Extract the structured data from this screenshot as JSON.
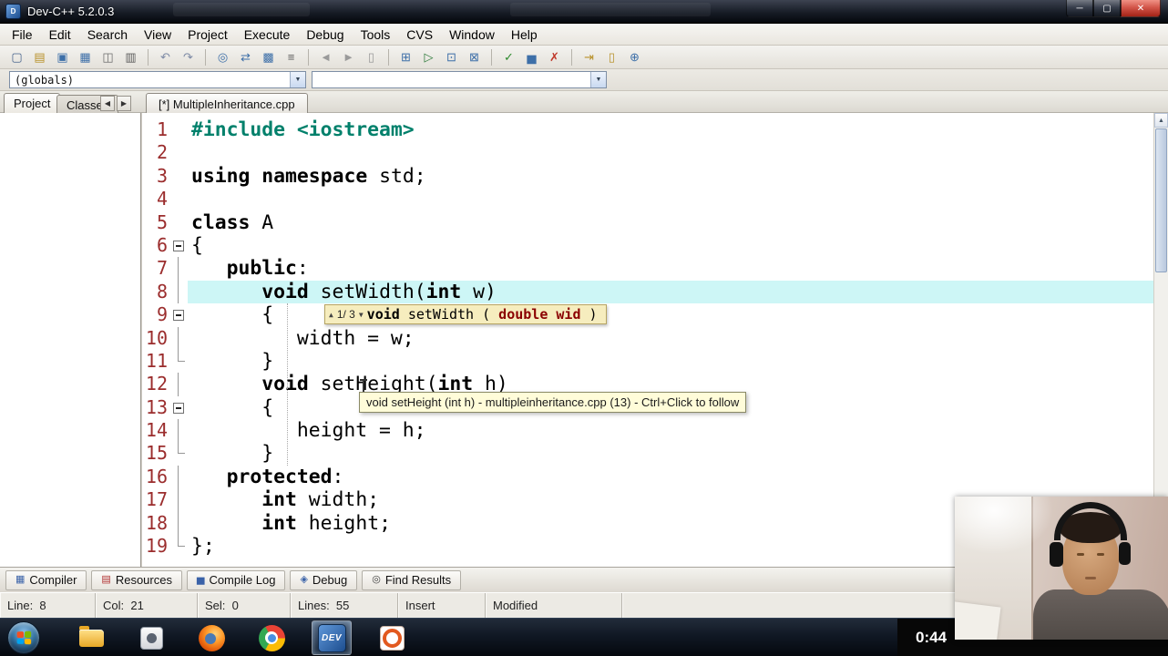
{
  "window": {
    "title": "Dev-C++ 5.2.0.3"
  },
  "menu": {
    "items": [
      "File",
      "Edit",
      "Search",
      "View",
      "Project",
      "Execute",
      "Debug",
      "Tools",
      "CVS",
      "Window",
      "Help"
    ]
  },
  "toolbar": {
    "items": [
      {
        "name": "new-file",
        "glyph": "▢",
        "color": "#46628c"
      },
      {
        "name": "open",
        "glyph": "▤",
        "color": "#b8912a"
      },
      {
        "name": "save",
        "glyph": "▣",
        "color": "#3d6fa8"
      },
      {
        "name": "save-all",
        "glyph": "▦",
        "color": "#3d6fa8"
      },
      {
        "name": "close-file",
        "glyph": "◫",
        "color": "#6d6d6d"
      },
      {
        "name": "print",
        "glyph": "▥",
        "color": "#5c5c5c"
      },
      {
        "sep": true
      },
      {
        "name": "undo",
        "glyph": "↶",
        "color": "#7d8aa5"
      },
      {
        "name": "redo",
        "glyph": "↷",
        "color": "#7d8aa5"
      },
      {
        "sep": true
      },
      {
        "name": "find",
        "glyph": "◎",
        "color": "#3d6fa8"
      },
      {
        "name": "replace",
        "glyph": "⇄",
        "color": "#3d6fa8"
      },
      {
        "name": "find-in-files",
        "glyph": "▩",
        "color": "#3d6fa8"
      },
      {
        "name": "goto-line",
        "glyph": "≡",
        "color": "#5c5c5c"
      },
      {
        "sep": true
      },
      {
        "name": "back",
        "glyph": "◄",
        "color": "#9a9a9a"
      },
      {
        "name": "forward",
        "glyph": "►",
        "color": "#9a9a9a"
      },
      {
        "name": "bookmarks",
        "glyph": "▯",
        "color": "#9a9a9a"
      },
      {
        "sep": true
      },
      {
        "name": "compile",
        "glyph": "⊞",
        "color": "#3d6fa8"
      },
      {
        "name": "run",
        "glyph": "▷",
        "color": "#2d7a3a"
      },
      {
        "name": "compile-and-run",
        "glyph": "⊡",
        "color": "#3d6fa8"
      },
      {
        "name": "rebuild-all",
        "glyph": "⊠",
        "color": "#3d6fa8"
      },
      {
        "sep": true
      },
      {
        "name": "syntax-check",
        "glyph": "✓",
        "color": "#2d8a2d"
      },
      {
        "name": "profile",
        "glyph": "▅",
        "color": "#3d6fa8"
      },
      {
        "name": "delete-profiling",
        "glyph": "✗",
        "color": "#c0392b"
      },
      {
        "sep": true
      },
      {
        "name": "goto-bookmark",
        "glyph": "⇥",
        "color": "#b8912a"
      },
      {
        "name": "toggle-bookmark",
        "glyph": "▯",
        "color": "#b8912a"
      },
      {
        "name": "insert-special",
        "glyph": "⊕",
        "color": "#3d6fa8"
      }
    ]
  },
  "combos": {
    "globals": "(globals)",
    "members": ""
  },
  "left_panel": {
    "tabs": [
      {
        "label": "Project"
      },
      {
        "label": "Classes"
      }
    ]
  },
  "editor": {
    "tab_label": "[*] MultipleInheritance.cpp"
  },
  "code": {
    "lines": [
      {
        "n": 1,
        "fold": "none",
        "hl": false,
        "seg": [
          [
            "#include <iostream>",
            "pre"
          ]
        ]
      },
      {
        "n": 2,
        "fold": "none",
        "hl": false,
        "seg": []
      },
      {
        "n": 3,
        "fold": "none",
        "hl": false,
        "seg": [
          [
            "using",
            "kw"
          ],
          [
            " ",
            "pl"
          ],
          [
            "namespace",
            "kw"
          ],
          [
            " std;",
            "pl"
          ]
        ]
      },
      {
        "n": 4,
        "fold": "none",
        "hl": false,
        "seg": []
      },
      {
        "n": 5,
        "fold": "none",
        "hl": false,
        "seg": [
          [
            "class",
            "kw"
          ],
          [
            " A",
            "pl"
          ]
        ]
      },
      {
        "n": 6,
        "fold": "box",
        "hl": false,
        "seg": [
          [
            "{",
            "pl"
          ]
        ]
      },
      {
        "n": 7,
        "fold": "cont",
        "hl": false,
        "seg": [
          [
            "   ",
            "pl"
          ],
          [
            "public",
            "kw"
          ],
          [
            ":",
            "pl"
          ]
        ]
      },
      {
        "n": 8,
        "fold": "cont",
        "hl": true,
        "seg": [
          [
            "      ",
            "pl"
          ],
          [
            "void",
            "kw"
          ],
          [
            " setWidth(",
            "pl"
          ],
          [
            "int",
            "kw"
          ],
          [
            " w)",
            "pl"
          ]
        ]
      },
      {
        "n": 9,
        "fold": "box",
        "hl": false,
        "seg": [
          [
            "      {",
            "pl"
          ]
        ]
      },
      {
        "n": 10,
        "fold": "cont",
        "hl": false,
        "seg": [
          [
            "         width = w;",
            "pl"
          ]
        ]
      },
      {
        "n": 11,
        "fold": "end",
        "hl": false,
        "seg": [
          [
            "      }",
            "pl"
          ]
        ]
      },
      {
        "n": 12,
        "fold": "cont",
        "hl": false,
        "seg": [
          [
            "      ",
            "pl"
          ],
          [
            "void",
            "kw"
          ],
          [
            " setHeight(",
            "pl"
          ],
          [
            "int",
            "kw"
          ],
          [
            " h)",
            "pl"
          ]
        ]
      },
      {
        "n": 13,
        "fold": "box",
        "hl": false,
        "seg": [
          [
            "      {",
            "pl"
          ]
        ]
      },
      {
        "n": 14,
        "fold": "cont",
        "hl": false,
        "seg": [
          [
            "         height = h;",
            "pl"
          ]
        ]
      },
      {
        "n": 15,
        "fold": "end",
        "hl": false,
        "seg": [
          [
            "      }",
            "pl"
          ]
        ]
      },
      {
        "n": 16,
        "fold": "cont",
        "hl": false,
        "seg": [
          [
            "   ",
            "pl"
          ],
          [
            "protected",
            "kw"
          ],
          [
            ":",
            "pl"
          ]
        ]
      },
      {
        "n": 17,
        "fold": "cont",
        "hl": false,
        "seg": [
          [
            "      ",
            "pl"
          ],
          [
            "int",
            "kw"
          ],
          [
            " width;",
            "pl"
          ]
        ]
      },
      {
        "n": 18,
        "fold": "cont",
        "hl": false,
        "seg": [
          [
            "      ",
            "pl"
          ],
          [
            "int",
            "kw"
          ],
          [
            " height;",
            "pl"
          ]
        ]
      },
      {
        "n": 19,
        "fold": "end",
        "hl": false,
        "seg": [
          [
            "};",
            "pl"
          ]
        ]
      }
    ]
  },
  "popups": {
    "completion": {
      "counter": "1/ 3",
      "seg": [
        [
          "void",
          "kw"
        ],
        [
          " setWidth ( ",
          "pl"
        ],
        [
          "double wid",
          "em"
        ],
        [
          " )",
          "pl"
        ]
      ]
    },
    "tooltip": "void setHeight (int h) - multipleinheritance.cpp (13) - Ctrl+Click to follow"
  },
  "bottom_tabs": [
    {
      "label": "Compiler",
      "glyph": "▦",
      "color": "#3a62a8"
    },
    {
      "label": "Resources",
      "glyph": "▤",
      "color": "#b03030"
    },
    {
      "label": "Compile Log",
      "glyph": "▅",
      "color": "#3a62a8"
    },
    {
      "label": "Debug",
      "glyph": "◈",
      "color": "#3a62a8"
    },
    {
      "label": "Find Results",
      "glyph": "◎",
      "color": "#444444"
    }
  ],
  "status": {
    "fields": [
      {
        "key": "line",
        "label": "Line:",
        "value": "8"
      },
      {
        "key": "col",
        "label": "Col:",
        "value": "21"
      },
      {
        "key": "sel",
        "label": "Sel:",
        "value": "0"
      },
      {
        "key": "lines",
        "label": "Lines:",
        "value": "55"
      },
      {
        "key": "mode",
        "label": "",
        "value": "Insert"
      },
      {
        "key": "modified",
        "label": "",
        "value": "Modified"
      }
    ]
  },
  "taskbar": {
    "timer": "0:44",
    "icons": [
      {
        "name": "explorer"
      },
      {
        "name": "app"
      },
      {
        "name": "firefox"
      },
      {
        "name": "chrome"
      },
      {
        "name": "devcpp",
        "label": "DEV",
        "active": true
      },
      {
        "name": "recorder"
      }
    ]
  },
  "colors": {
    "line-highlight": "#cdf6f6",
    "tooltip-bg": "#fffcd9",
    "popup-bg": "#f6edbe",
    "keyword-em": "#8b0000",
    "preproc": "#00806b",
    "gutter-num": "#9b2d2d"
  }
}
